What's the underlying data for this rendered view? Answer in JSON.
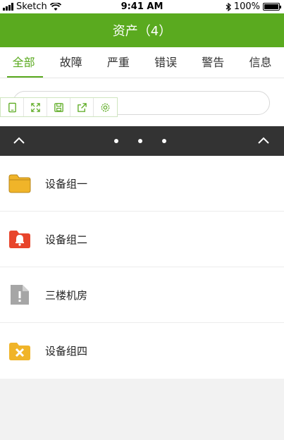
{
  "status_bar": {
    "carrier": "Sketch",
    "time": "9:41 AM",
    "battery": "100%"
  },
  "nav": {
    "title": "资产（4）"
  },
  "tabs": [
    {
      "label": "全部",
      "active": true
    },
    {
      "label": "故障",
      "active": false
    },
    {
      "label": "严重",
      "active": false
    },
    {
      "label": "错误",
      "active": false
    },
    {
      "label": "警告",
      "active": false
    },
    {
      "label": "信息",
      "active": false
    }
  ],
  "search": {
    "placeholder": ""
  },
  "toolbar_icons": [
    "page-icon",
    "expand-icon",
    "save-icon",
    "share-icon",
    "settings-icon"
  ],
  "assets": [
    {
      "label": "设备组一",
      "icon": "folder-icon",
      "color": "#f0b429"
    },
    {
      "label": "设备组二",
      "icon": "folder-alarm-icon",
      "color": "#e8452c"
    },
    {
      "label": "三楼机房",
      "icon": "file-warning-icon",
      "color": "#a6a6a6"
    },
    {
      "label": "设备组四",
      "icon": "folder-error-icon",
      "color": "#f0b429"
    }
  ],
  "colors": {
    "accent": "#5aaa1f",
    "dark_bar": "#333333"
  }
}
